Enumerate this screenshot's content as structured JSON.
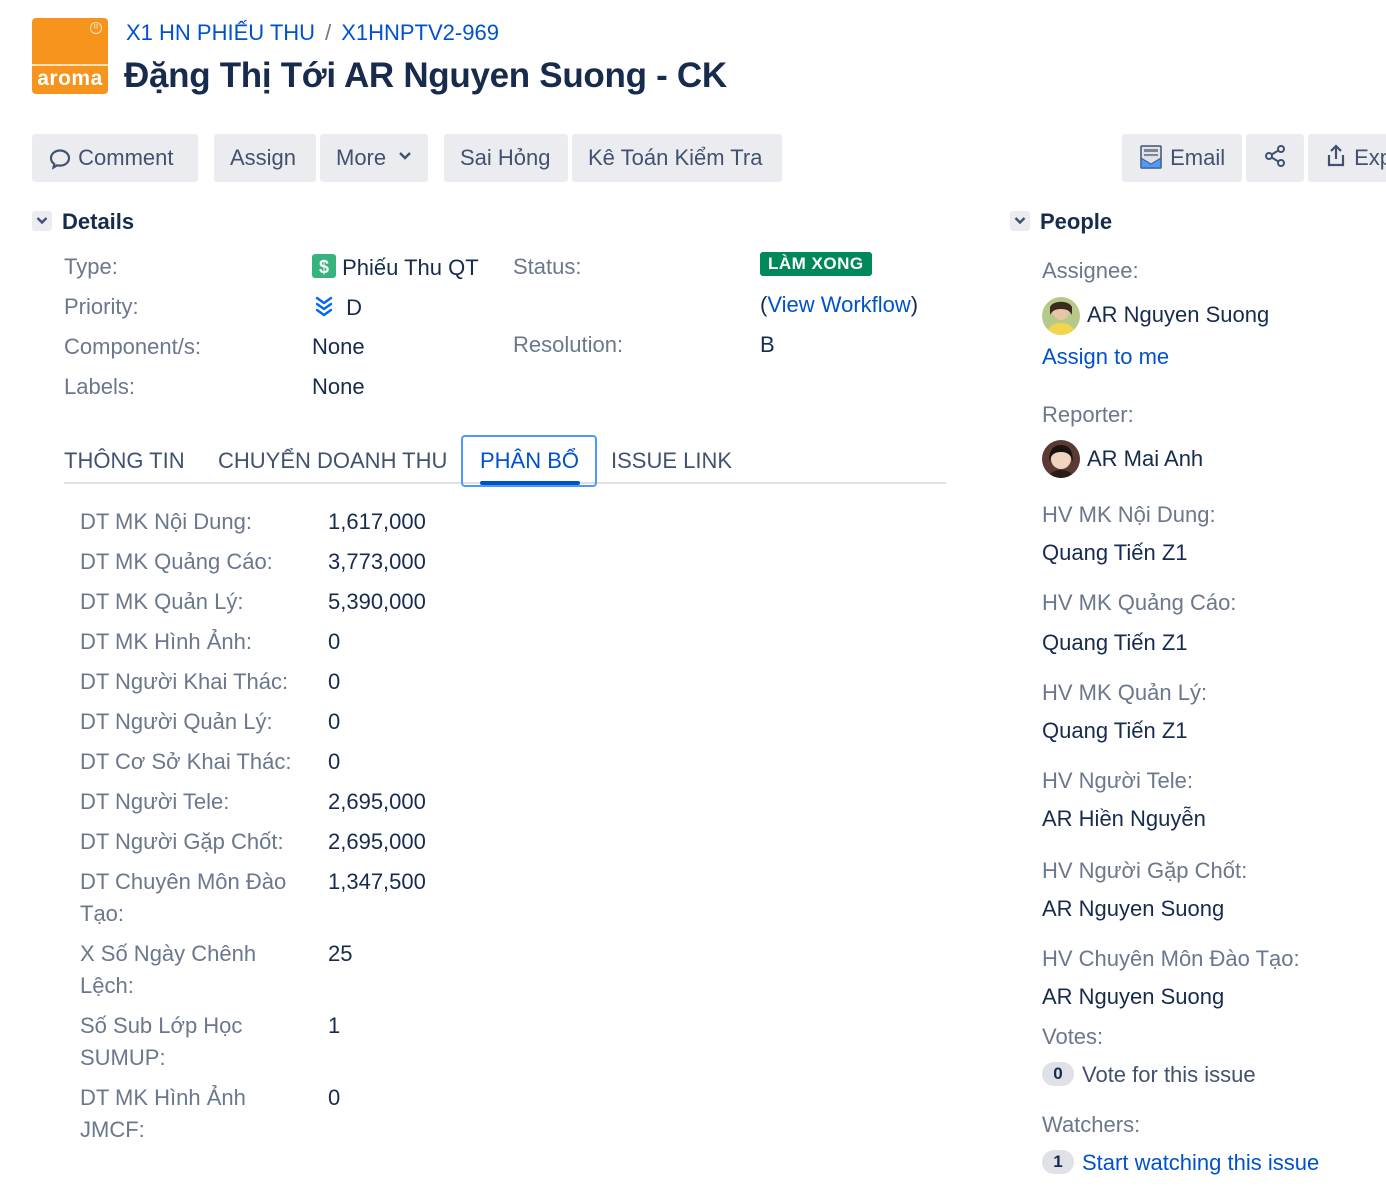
{
  "header": {
    "logo_text": "aroma",
    "breadcrumb_project": "X1 HN PHIẾU THU",
    "breadcrumb_sep": "/",
    "breadcrumb_issue_key": "X1HNPTV2-969",
    "title": "Đặng Thị Tới AR Nguyen Suong - CK"
  },
  "toolbar": {
    "comment": "Comment",
    "assign": "Assign",
    "more": "More",
    "sai_hong": "Sai Hỏng",
    "ke_toan": "Kê Toán Kiểm Tra",
    "email": "Email",
    "export": "Export"
  },
  "details": {
    "heading": "Details",
    "type_label": "Type:",
    "type_value": "Phiếu Thu QT",
    "priority_label": "Priority:",
    "priority_value": "D",
    "component_label": "Component/s:",
    "component_value": "None",
    "labels_label": "Labels:",
    "labels_value": "None",
    "status_label": "Status:",
    "status_value": "LÀM XONG",
    "view_workflow_open": "(",
    "view_workflow": "View Workflow",
    "view_workflow_close": ")",
    "resolution_label": "Resolution:",
    "resolution_value": "B"
  },
  "tabs": {
    "t1": "THÔNG TIN",
    "t2": "CHUYỂN DOANH THU",
    "t3": "PHÂN BỔ",
    "t4": "ISSUE LINK",
    "active": "PHÂN BỔ"
  },
  "fields": [
    {
      "label": "DT MK Nội Dung:",
      "value": "1,617,000"
    },
    {
      "label": "DT MK Quảng Cáo:",
      "value": "3,773,000"
    },
    {
      "label": "DT MK Quản Lý:",
      "value": "5,390,000"
    },
    {
      "label": "DT MK Hình Ảnh:",
      "value": "0"
    },
    {
      "label": "DT Người Khai Thác:",
      "value": "0"
    },
    {
      "label": "DT Người Quản Lý:",
      "value": "0"
    },
    {
      "label": "DT Cơ Sở Khai Thác:",
      "value": "0"
    },
    {
      "label": "DT Người Tele:",
      "value": "2,695,000"
    },
    {
      "label": "DT Người Gặp Chốt:",
      "value": "2,695,000"
    },
    {
      "label": "DT Chuyên Môn Đào Tạo:",
      "value": "1,347,500"
    },
    {
      "label": "X Số Ngày Chênh Lệch:",
      "value": "25"
    },
    {
      "label": "Số Sub Lớp Học SUMUP:",
      "value": "1"
    },
    {
      "label": "DT MK Hình Ảnh JMCF:",
      "value": "0"
    }
  ],
  "people": {
    "heading": "People",
    "assignee_label": "Assignee:",
    "assignee": "AR Nguyen Suong",
    "assign_to_me": "Assign to me",
    "reporter_label": "Reporter:",
    "reporter": "AR Mai Anh",
    "hv_noi_dung_label": "HV MK Nội Dung:",
    "hv_noi_dung": "Quang Tiến Z1",
    "hv_quang_cao_label": "HV MK Quảng Cáo:",
    "hv_quang_cao": "Quang Tiến Z1",
    "hv_quan_ly_label": "HV MK Quản Lý:",
    "hv_quan_ly": "Quang Tiến Z1",
    "hv_tele_label": "HV Người Tele:",
    "hv_tele": "AR Hiền Nguyễn",
    "hv_gap_chot_label": "HV Người Gặp Chốt:",
    "hv_gap_chot": "AR Nguyen Suong",
    "hv_dao_tao_label": "HV Chuyên Môn Đào Tạo:",
    "hv_dao_tao": "AR Nguyen Suong",
    "votes_label": "Votes:",
    "votes_count": "0",
    "vote_link": "Vote for this issue",
    "watchers_label": "Watchers:",
    "watchers_count": "1",
    "watch_link": "Start watching this issue"
  },
  "colors": {
    "link": "#0052cc",
    "status_done": "#00875a",
    "logo": "#f7941d",
    "button_bg": "#ebecf0"
  },
  "icons": [
    "comment-icon",
    "chevron-down-icon",
    "email-icon",
    "share-icon",
    "export-icon",
    "dollar-icon",
    "priority-lowest-icon"
  ]
}
